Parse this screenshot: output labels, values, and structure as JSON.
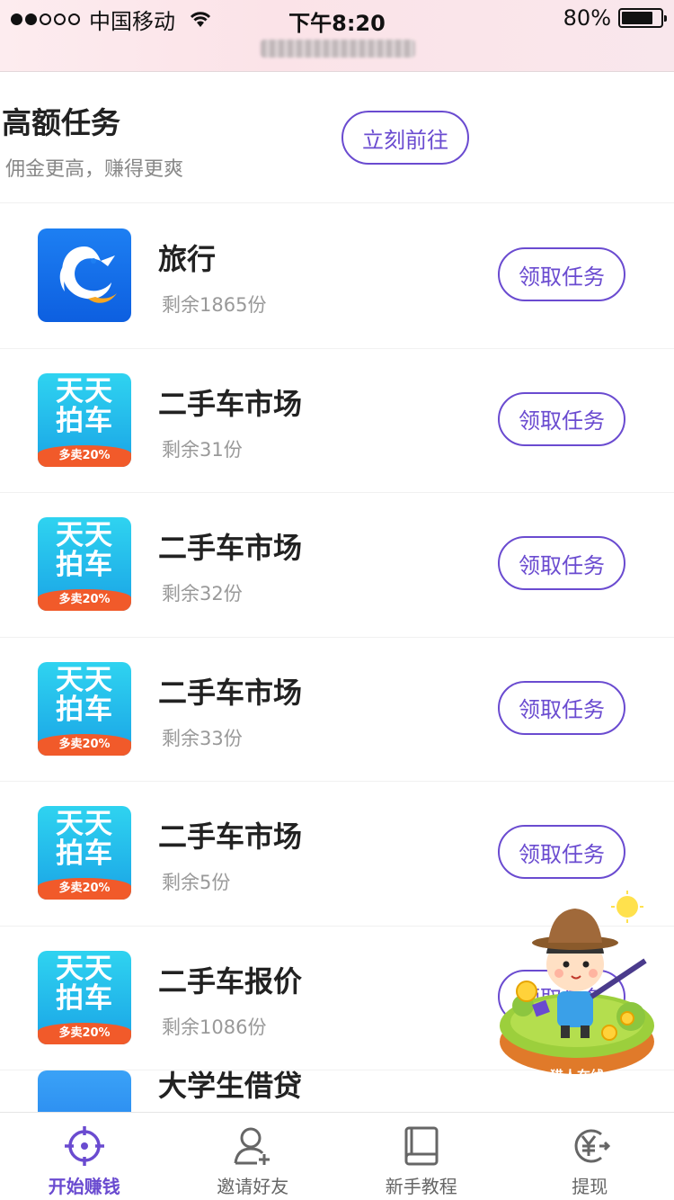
{
  "status_bar": {
    "carrier": "中国移动",
    "time": "下午8:20",
    "battery": "80%",
    "battery_level": 0.8
  },
  "header": {
    "title": "高额任务",
    "subtitle": "佣金更高，赚得更爽",
    "go_label": "立刻前往"
  },
  "tasks": [
    {
      "name": "旅行",
      "remaining": "剩余1865份",
      "button": "领取任务",
      "icon": "dolphin-icon"
    },
    {
      "name": "二手车市场",
      "remaining": "剩余31份",
      "button": "领取任务",
      "icon": "paiche-icon"
    },
    {
      "name": "二手车市场",
      "remaining": "剩余32份",
      "button": "领取任务",
      "icon": "paiche-icon"
    },
    {
      "name": "二手车市场",
      "remaining": "剩余33份",
      "button": "领取任务",
      "icon": "paiche-icon"
    },
    {
      "name": "二手车市场",
      "remaining": "剩余5份",
      "button": "领取任务",
      "icon": "paiche-icon"
    },
    {
      "name": "二手车报价",
      "remaining": "剩余1086份",
      "button": "领取任务",
      "icon": "paiche-icon"
    }
  ],
  "paiche_icon": {
    "line1": "天天",
    "line2": "拍车",
    "badge": "多卖20%"
  },
  "partial_row": {
    "name": "大学生借贷"
  },
  "mascot": {
    "label": "猎人在线"
  },
  "tabbar": {
    "items": [
      {
        "label": "开始赚钱",
        "icon": "crosshair-icon",
        "active": true
      },
      {
        "label": "邀请好友",
        "icon": "add-user-icon",
        "active": false
      },
      {
        "label": "新手教程",
        "icon": "book-icon",
        "active": false
      },
      {
        "label": "提现",
        "icon": "yuan-withdraw-icon",
        "active": false
      }
    ]
  },
  "colors": {
    "accent": "#6a4bd0",
    "text": "#222222",
    "muted": "#999999"
  }
}
